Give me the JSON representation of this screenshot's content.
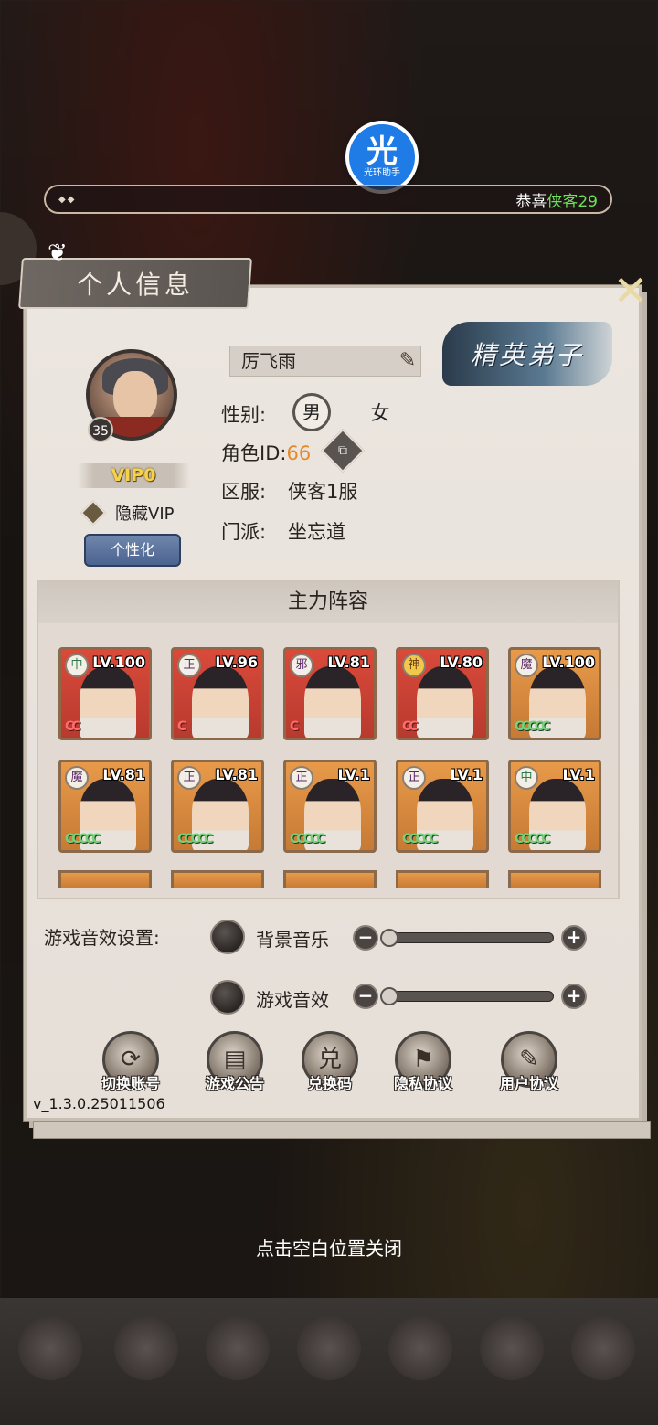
{
  "assistant": {
    "glyph": "光",
    "label": "光环助手"
  },
  "marquee": {
    "prefix": "恭喜",
    "highlight": "侠客29"
  },
  "panel": {
    "title": "个人信息",
    "close_glyph": "✕"
  },
  "profile": {
    "level": "35",
    "vip": "VIP0",
    "hide_vip_label": "隐藏VIP",
    "personalize_label": "个性化",
    "name": "厉飞雨",
    "rank_badge": "精英弟子",
    "gender_label": "性别:",
    "gender_male": "男",
    "gender_female": "女",
    "role_id_label": "角色ID:",
    "role_id_value": "66",
    "copy_glyph": "⧉",
    "server_label": "区服:",
    "server_value": "侠客1服",
    "sect_label": "门派:",
    "sect_value": "坐忘道"
  },
  "lineup": {
    "title": "主力阵容",
    "heroes": [
      {
        "faction": "中",
        "level": "LV.100",
        "coins": "CC",
        "bg": "red"
      },
      {
        "faction": "正",
        "level": "LV.96",
        "coins": "C",
        "bg": "red"
      },
      {
        "faction": "邪",
        "level": "LV.81",
        "coins": "C",
        "bg": "red"
      },
      {
        "faction": "神",
        "level": "LV.80",
        "coins": "CC",
        "bg": "red"
      },
      {
        "faction": "魔",
        "level": "LV.100",
        "coins": "CCCCC",
        "bg": "orange"
      },
      {
        "faction": "魔",
        "level": "LV.81",
        "coins": "CCCCC",
        "bg": "orange"
      },
      {
        "faction": "正",
        "level": "LV.81",
        "coins": "CCCCC",
        "bg": "orange"
      },
      {
        "faction": "正",
        "level": "LV.1",
        "coins": "CCCCC",
        "bg": "orange"
      },
      {
        "faction": "正",
        "level": "LV.1",
        "coins": "CCCCC",
        "bg": "orange"
      },
      {
        "faction": "中",
        "level": "LV.1",
        "coins": "CCCCC",
        "bg": "orange"
      }
    ]
  },
  "audio": {
    "section_label": "游戏音效设置:",
    "bgm_label": "背景音乐",
    "sfx_label": "游戏音效",
    "minus": "−",
    "plus": "+",
    "bgm_level": 0,
    "sfx_level": 0
  },
  "menu": [
    {
      "label": "切换账号",
      "icon": "switch-account-icon",
      "glyph": "⟳"
    },
    {
      "label": "游戏公告",
      "icon": "announcement-icon",
      "glyph": "▤"
    },
    {
      "label": "兑换码",
      "icon": "redeem-code-icon",
      "glyph": "兑"
    },
    {
      "label": "隐私协议",
      "icon": "privacy-policy-icon",
      "glyph": "⚑"
    },
    {
      "label": "用户协议",
      "icon": "user-agreement-icon",
      "glyph": "✎"
    }
  ],
  "version": "v_1.3.0.25011506",
  "close_hint": "点击空白位置关闭"
}
